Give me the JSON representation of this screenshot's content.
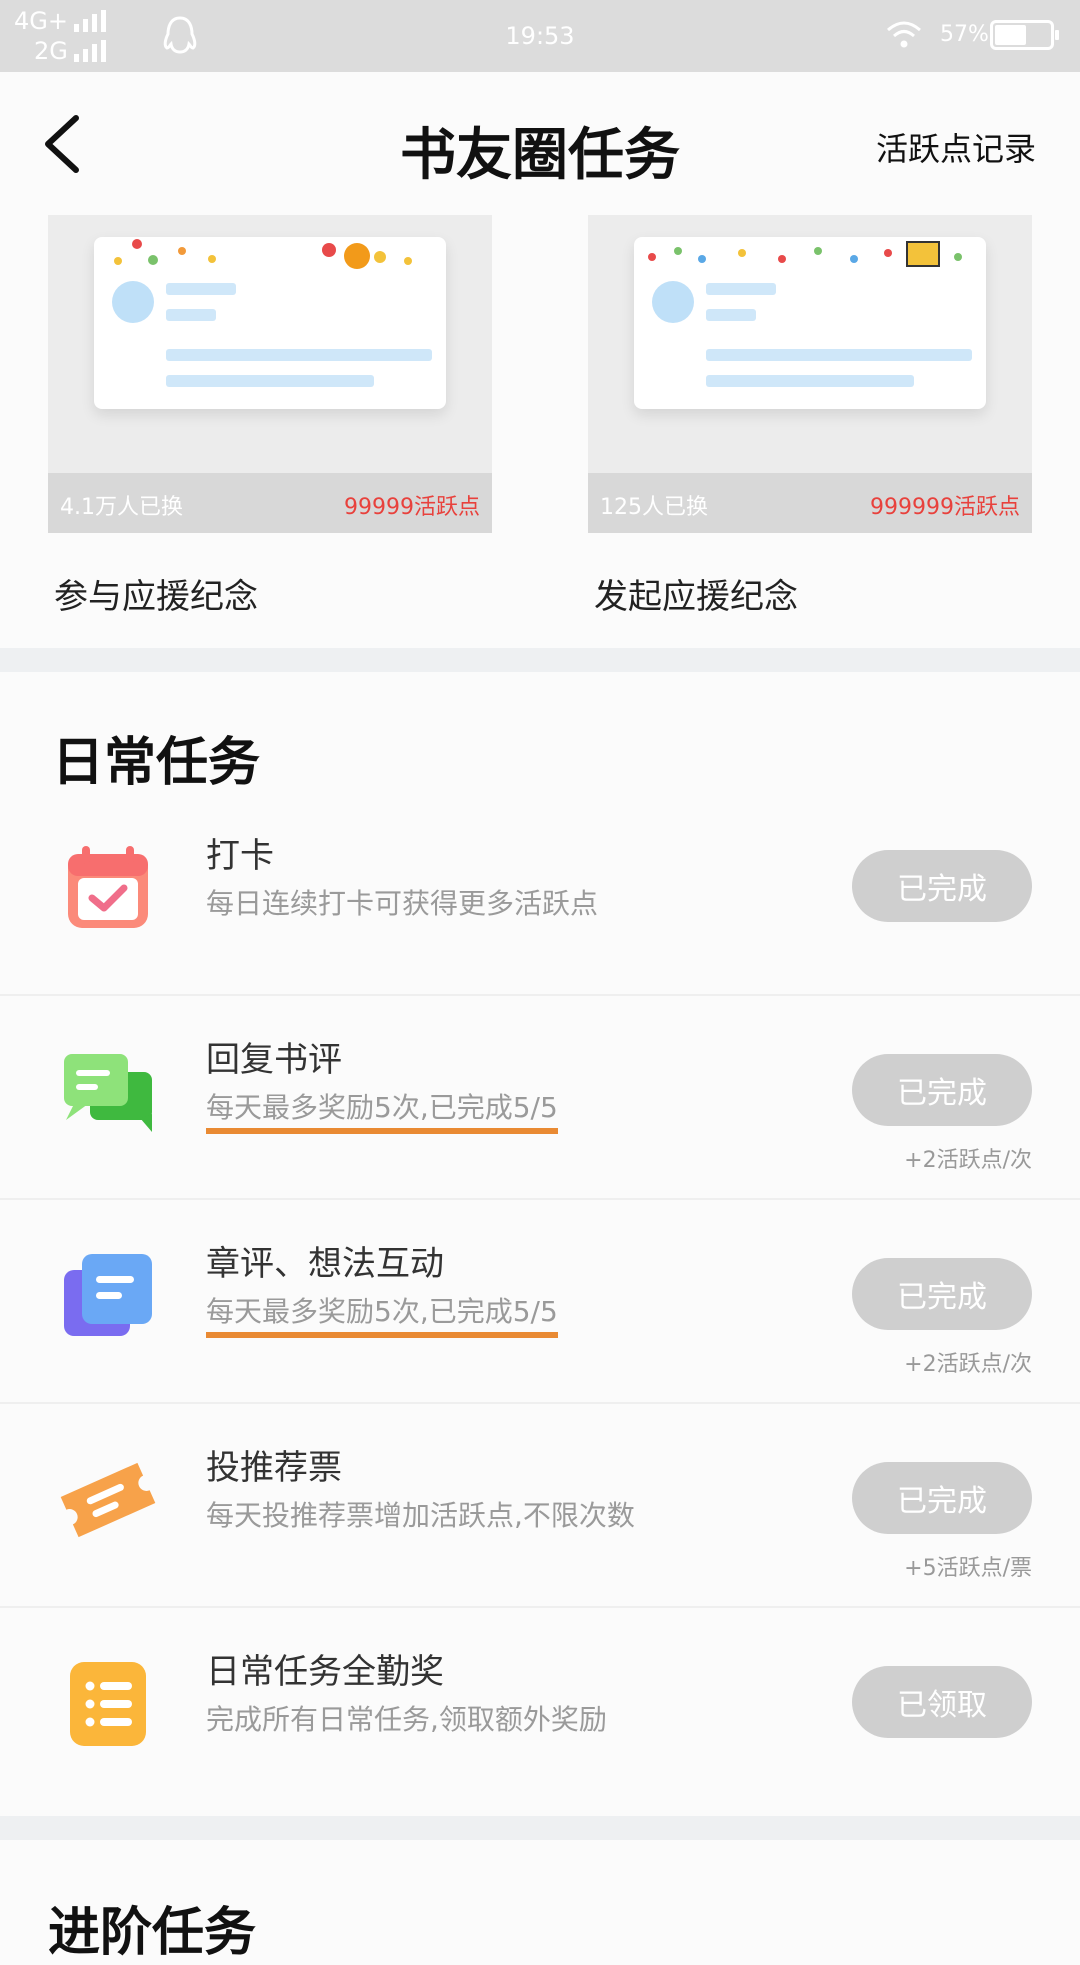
{
  "status_bar": {
    "network_top": "4G+",
    "network_bottom": "2G",
    "time": "19:53",
    "battery": "57%",
    "battery_level": 0.57
  },
  "header": {
    "title": "书友圈任务",
    "record_link": "活跃点记录"
  },
  "commemoration_cards": [
    {
      "participants": "4.1万人已换",
      "cost": "99999活跃点",
      "caption": "参与应援纪念"
    },
    {
      "participants": "125人已换",
      "cost": "999999活跃点",
      "caption": "发起应援纪念"
    }
  ],
  "daily_section": {
    "title": "日常任务",
    "tasks": [
      {
        "icon": "calendar-check-icon",
        "name": "打卡",
        "desc": "每日连续打卡可获得更多活跃点",
        "button": "已完成",
        "reward": ""
      },
      {
        "icon": "chat-bubbles-icon",
        "name": "回复书评",
        "desc": "每天最多奖励5次,已完成5/5",
        "button": "已完成",
        "reward": "+2活跃点/次"
      },
      {
        "icon": "stacked-notes-icon",
        "name": "章评、想法互动",
        "desc": "每天最多奖励5次,已完成5/5",
        "button": "已完成",
        "reward": "+2活跃点/次"
      },
      {
        "icon": "ticket-icon",
        "name": "投推荐票",
        "desc": "每天投推荐票增加活跃点,不限次数",
        "button": "已完成",
        "reward": "+5活跃点/票"
      },
      {
        "icon": "list-icon",
        "name": "日常任务全勤奖",
        "desc": "完成所有日常任务,领取额外奖励",
        "button": "已领取",
        "reward": ""
      }
    ]
  },
  "advanced_section": {
    "title": "进阶任务"
  },
  "colors": {
    "status_bar_bg": "#dcdcdc",
    "button_disabled": "#cfcfcf",
    "price_red": "#e8413c",
    "highlight_underline": "#e98a33"
  }
}
